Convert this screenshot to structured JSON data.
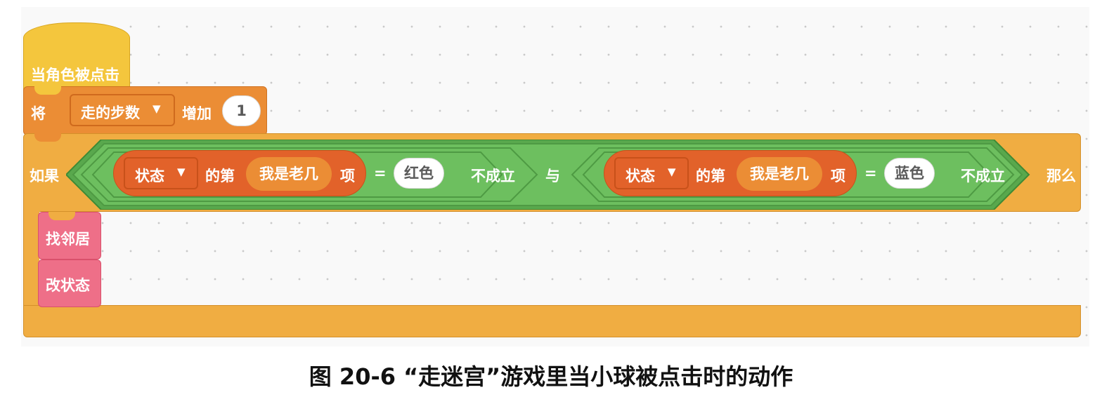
{
  "blocks": {
    "hat_label": "当角色被点击",
    "change": {
      "prefix": "将",
      "variable": "走的步数",
      "verb": "增加",
      "value": "1"
    },
    "if": {
      "if_label": "如果",
      "and_label": "与",
      "then_label": "那么",
      "left_condition": {
        "list": "状态",
        "of_label": "的第",
        "index_var": "我是老几",
        "item_label": "项",
        "equals": "=",
        "value": "红色",
        "negation": "不成立"
      },
      "right_condition": {
        "list": "状态",
        "of_label": "的第",
        "index_var": "我是老几",
        "item_label": "项",
        "equals": "=",
        "value": "蓝色",
        "negation": "不成立"
      }
    },
    "custom_blocks": [
      "找邻居",
      "改状态"
    ]
  },
  "caption": "图 20-6  “走迷宫”游戏里当小球被点击时的动作",
  "colors": {
    "events": "#f4c63d",
    "variables": "#eb8d35",
    "control": "#f0ad42",
    "operators": "#6dbf5f",
    "lists": "#e2622a",
    "custom": "#ee6f88"
  }
}
